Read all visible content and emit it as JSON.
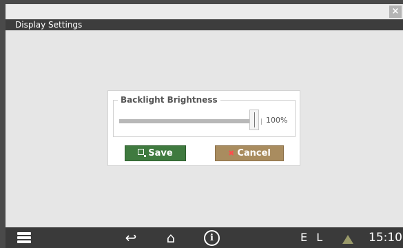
{
  "window": {
    "title": "Display Settings",
    "close_label": "×"
  },
  "dialog": {
    "group_label": "Backlight Brightness",
    "brightness": {
      "value_percent": 100,
      "value_label": "100%"
    },
    "save_label": "Save",
    "cancel_label": "Cancel"
  },
  "taskbar": {
    "icons": [
      "menu-icon",
      "back-icon",
      "home-icon",
      "info-icon",
      "warning-icon"
    ],
    "language_label": "E L",
    "clock": "15:10"
  },
  "colors": {
    "save_button": "#3f7a3f",
    "cancel_button": "#a98c5f",
    "title_bar": "#3d3d3d",
    "taskbar": "#3a3a3a"
  }
}
